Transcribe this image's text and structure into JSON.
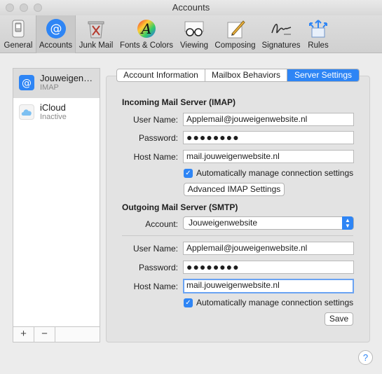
{
  "window": {
    "title": "Accounts"
  },
  "toolbar": {
    "items": [
      {
        "label": "General",
        "icon": "general-switch-icon"
      },
      {
        "label": "Accounts",
        "icon": "at-sign-icon",
        "selected": true
      },
      {
        "label": "Junk Mail",
        "icon": "trash-bin-icon"
      },
      {
        "label": "Fonts & Colors",
        "icon": "fonts-colors-icon"
      },
      {
        "label": "Viewing",
        "icon": "glasses-icon"
      },
      {
        "label": "Composing",
        "icon": "pencil-paper-icon"
      },
      {
        "label": "Signatures",
        "icon": "signature-icon"
      },
      {
        "label": "Rules",
        "icon": "rules-arrows-icon"
      }
    ]
  },
  "sidebar": {
    "accounts": [
      {
        "name": "Jouweigen…",
        "type": "IMAP",
        "selected": true,
        "icon": "at-sign-icon"
      },
      {
        "name": "iCloud",
        "type": "Inactive",
        "selected": false,
        "icon": "cloud-icon"
      }
    ],
    "add_label": "+",
    "remove_label": "−"
  },
  "tabs": [
    {
      "label": "Account Information",
      "active": false
    },
    {
      "label": "Mailbox Behaviors",
      "active": false
    },
    {
      "label": "Server Settings",
      "active": true
    }
  ],
  "incoming": {
    "heading": "Incoming Mail Server (IMAP)",
    "user_name_label": "User Name:",
    "user_name": "Applemail@jouweigenwebsite.nl",
    "password_label": "Password:",
    "password": "●●●●●●●●",
    "host_name_label": "Host Name:",
    "host_name": "mail.jouweigenwebsite.nl",
    "auto_manage_label": "Automatically manage connection settings",
    "auto_manage_checked": true,
    "advanced_button": "Advanced IMAP Settings"
  },
  "outgoing": {
    "heading": "Outgoing Mail Server (SMTP)",
    "account_label": "Account:",
    "account_value": "Jouweigenwebsite",
    "user_name_label": "User Name:",
    "user_name": "Applemail@jouweigenwebsite.nl",
    "password_label": "Password:",
    "password": "●●●●●●●●",
    "host_name_label": "Host Name:",
    "host_name": "mail.jouweigenwebsite.nl",
    "auto_manage_label": "Automatically manage connection settings",
    "auto_manage_checked": true,
    "save_button": "Save"
  },
  "help_label": "?",
  "colors": {
    "accent": "#2e85f5",
    "window_bg": "#ececec"
  }
}
